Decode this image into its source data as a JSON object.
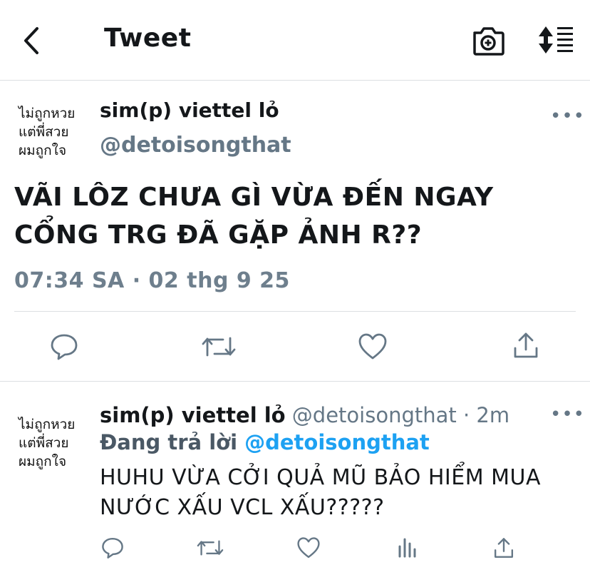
{
  "header": {
    "title": "Tweet",
    "back_icon": "chevron-left-icon",
    "camera_icon": "camera-plus-icon",
    "sort_icon": "sort-icon"
  },
  "main_tweet": {
    "avatar_lines": [
      "ไม่ถูกหวย",
      "แต่พี่สวย",
      "ผมถูกใจ"
    ],
    "name": "sim(p) viettel lỏ",
    "handle": "@detoisongthat",
    "more": "•••",
    "text_lines": [
      "VÃI LÔZ CHƯA GÌ VỪA ĐẾN NGAY",
      "CỔNG TRG ĐÃ GẶP ẢNH R??"
    ],
    "timestamp": "07:34 SA · 02 thg 9 25",
    "actions": [
      "reply-icon",
      "retweet-icon",
      "like-icon",
      "share-icon"
    ]
  },
  "reply_tweet": {
    "avatar_lines": [
      "ไม่ถูกหวย",
      "แต่พี่สวย",
      "ผมถูกใจ"
    ],
    "name": "sim(p) viettel lỏ",
    "handle_time": " @detoisongthat · 2m",
    "more": "•••",
    "replying_prefix": "Đang trả lời ",
    "replying_handle": "@detoisongthat",
    "text_lines": [
      "HUHU VỪA CỞI QUẢ MŨ BẢO HIỂM MUA",
      "NƯỚC XẤU VCL XẤU?????"
    ],
    "actions": [
      "reply-icon",
      "retweet-icon",
      "like-icon",
      "analytics-icon",
      "share-icon"
    ]
  },
  "colors": {
    "text": "#14171a",
    "muted": "#657786",
    "accent": "#1da1f2",
    "divider": "#dcdfe2"
  }
}
